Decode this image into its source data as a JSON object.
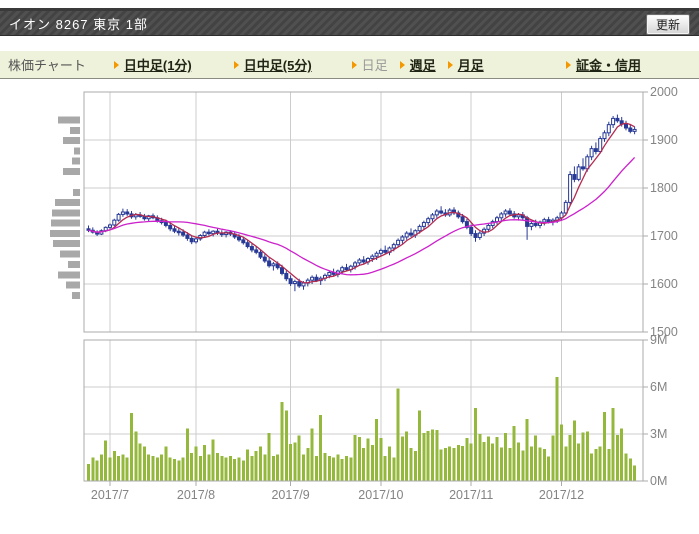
{
  "header": {
    "title": "イオン 8267 東京 1部",
    "refresh_button": "更新"
  },
  "tabbar": {
    "label": "株価チャート",
    "tabs": [
      {
        "id": "intraday-1min",
        "label": "日中足(1分)",
        "active": false
      },
      {
        "id": "intraday-5min",
        "label": "日中足(5分)",
        "active": false
      },
      {
        "id": "daily",
        "label": "日足",
        "active": true
      },
      {
        "id": "weekly",
        "label": "週足",
        "active": false
      },
      {
        "id": "monthly",
        "label": "月足",
        "active": false
      },
      {
        "id": "margin-credit",
        "label": "証金・信用",
        "active": false
      }
    ]
  },
  "colors": {
    "candle": "#283A96",
    "ma_short": "#B52B50",
    "ma_long": "#CC22CC",
    "volume_bar": "#93B83C",
    "profile_bar": "#A8A8A8",
    "grid": "#CCCCCC",
    "plot_border": "#ABABAB",
    "axis_text": "#848484",
    "tab_arrow": "#F39800",
    "tabbar_bg": "#EEF2DA"
  },
  "chart_data": [
    {
      "type": "candlestick",
      "ylim": [
        1500,
        2000
      ],
      "yticks": [
        2000,
        1900,
        1800,
        1700,
        1600,
        1500
      ],
      "grid": true,
      "legend": "none",
      "x_month_ticks": [
        {
          "day": 5,
          "label": "2017/7"
        },
        {
          "day": 25,
          "label": "2017/8"
        },
        {
          "day": 47,
          "label": "2017/9"
        },
        {
          "day": 68,
          "label": "2017/10"
        },
        {
          "day": 89,
          "label": "2017/11"
        },
        {
          "day": 110,
          "label": "2017/12"
        }
      ],
      "series": [
        {
          "name": "ohlc-candles",
          "type": "candle",
          "data": [
            [
              1715,
              1722,
              1708,
              1712
            ],
            [
              1712,
              1718,
              1705,
              1708
            ],
            [
              1708,
              1712,
              1700,
              1704
            ],
            [
              1704,
              1714,
              1702,
              1711
            ],
            [
              1711,
              1720,
              1708,
              1718
            ],
            [
              1718,
              1726,
              1714,
              1723
            ],
            [
              1723,
              1736,
              1720,
              1733
            ],
            [
              1733,
              1748,
              1730,
              1745
            ],
            [
              1745,
              1757,
              1740,
              1750
            ],
            [
              1750,
              1756,
              1742,
              1746
            ],
            [
              1746,
              1752,
              1736,
              1740
            ],
            [
              1740,
              1748,
              1734,
              1744
            ],
            [
              1744,
              1750,
              1738,
              1741
            ],
            [
              1741,
              1746,
              1732,
              1736
            ],
            [
              1736,
              1744,
              1730,
              1742
            ],
            [
              1742,
              1747,
              1735,
              1738
            ],
            [
              1738,
              1743,
              1728,
              1732
            ],
            [
              1732,
              1738,
              1724,
              1728
            ],
            [
              1728,
              1734,
              1718,
              1722
            ],
            [
              1722,
              1727,
              1710,
              1715
            ],
            [
              1715,
              1721,
              1706,
              1710
            ],
            [
              1710,
              1716,
              1701,
              1708
            ],
            [
              1708,
              1714,
              1698,
              1702
            ],
            [
              1702,
              1708,
              1690,
              1695
            ],
            [
              1695,
              1701,
              1683,
              1688
            ],
            [
              1688,
              1697,
              1684,
              1694
            ],
            [
              1694,
              1704,
              1690,
              1701
            ],
            [
              1701,
              1711,
              1697,
              1708
            ],
            [
              1708,
              1714,
              1701,
              1705
            ],
            [
              1705,
              1712,
              1699,
              1710
            ],
            [
              1710,
              1715,
              1702,
              1706
            ],
            [
              1706,
              1712,
              1698,
              1703
            ],
            [
              1703,
              1710,
              1697,
              1708
            ],
            [
              1708,
              1712,
              1700,
              1704
            ],
            [
              1704,
              1709,
              1694,
              1698
            ],
            [
              1698,
              1704,
              1688,
              1692
            ],
            [
              1692,
              1698,
              1682,
              1686
            ],
            [
              1686,
              1692,
              1674,
              1678
            ],
            [
              1678,
              1684,
              1666,
              1671
            ],
            [
              1671,
              1679,
              1662,
              1666
            ],
            [
              1666,
              1672,
              1652,
              1656
            ],
            [
              1656,
              1662,
              1644,
              1648
            ],
            [
              1648,
              1654,
              1634,
              1638
            ],
            [
              1638,
              1646,
              1628,
              1642
            ],
            [
              1642,
              1647,
              1630,
              1634
            ],
            [
              1634,
              1640,
              1618,
              1622
            ],
            [
              1622,
              1628,
              1606,
              1611
            ],
            [
              1611,
              1618,
              1596,
              1601
            ],
            [
              1601,
              1609,
              1585,
              1605
            ],
            [
              1605,
              1611,
              1592,
              1596
            ],
            [
              1596,
              1606,
              1588,
              1602
            ],
            [
              1602,
              1612,
              1595,
              1608
            ],
            [
              1608,
              1618,
              1600,
              1614
            ],
            [
              1614,
              1620,
              1604,
              1607
            ],
            [
              1607,
              1616,
              1598,
              1612
            ],
            [
              1612,
              1622,
              1606,
              1618
            ],
            [
              1618,
              1628,
              1612,
              1624
            ],
            [
              1624,
              1632,
              1616,
              1620
            ],
            [
              1620,
              1630,
              1614,
              1627
            ],
            [
              1627,
              1638,
              1621,
              1634
            ],
            [
              1634,
              1642,
              1626,
              1630
            ],
            [
              1630,
              1640,
              1624,
              1637
            ],
            [
              1637,
              1648,
              1630,
              1644
            ],
            [
              1644,
              1654,
              1638,
              1650
            ],
            [
              1650,
              1658,
              1642,
              1646
            ],
            [
              1646,
              1656,
              1640,
              1653
            ],
            [
              1653,
              1662,
              1646,
              1658
            ],
            [
              1658,
              1668,
              1650,
              1664
            ],
            [
              1664,
              1674,
              1658,
              1670
            ],
            [
              1670,
              1680,
              1662,
              1666
            ],
            [
              1666,
              1678,
              1660,
              1675
            ],
            [
              1675,
              1686,
              1668,
              1682
            ],
            [
              1682,
              1695,
              1676,
              1691
            ],
            [
              1691,
              1702,
              1684,
              1698
            ],
            [
              1698,
              1710,
              1692,
              1706
            ],
            [
              1706,
              1716,
              1698,
              1702
            ],
            [
              1702,
              1714,
              1696,
              1711
            ],
            [
              1711,
              1724,
              1705,
              1720
            ],
            [
              1720,
              1732,
              1714,
              1728
            ],
            [
              1728,
              1740,
              1722,
              1736
            ],
            [
              1736,
              1748,
              1730,
              1744
            ],
            [
              1744,
              1756,
              1738,
              1752
            ],
            [
              1752,
              1762,
              1745,
              1748
            ],
            [
              1748,
              1756,
              1740,
              1744
            ],
            [
              1744,
              1758,
              1740,
              1754
            ],
            [
              1754,
              1760,
              1744,
              1748
            ],
            [
              1748,
              1753,
              1736,
              1740
            ],
            [
              1740,
              1746,
              1726,
              1730
            ],
            [
              1730,
              1736,
              1714,
              1718
            ],
            [
              1718,
              1724,
              1700,
              1705
            ],
            [
              1705,
              1712,
              1688,
              1697
            ],
            [
              1697,
              1710,
              1692,
              1706
            ],
            [
              1706,
              1718,
              1700,
              1714
            ],
            [
              1714,
              1726,
              1708,
              1722
            ],
            [
              1722,
              1734,
              1716,
              1730
            ],
            [
              1730,
              1742,
              1724,
              1738
            ],
            [
              1738,
              1750,
              1732,
              1746
            ],
            [
              1746,
              1756,
              1740,
              1752
            ],
            [
              1752,
              1758,
              1742,
              1746
            ],
            [
              1746,
              1752,
              1736,
              1740
            ],
            [
              1740,
              1748,
              1732,
              1744
            ],
            [
              1744,
              1750,
              1734,
              1738
            ],
            [
              1738,
              1742,
              1692,
              1720
            ],
            [
              1720,
              1730,
              1712,
              1726
            ],
            [
              1726,
              1734,
              1718,
              1722
            ],
            [
              1722,
              1732,
              1716,
              1729
            ],
            [
              1729,
              1738,
              1722,
              1734
            ],
            [
              1734,
              1740,
              1726,
              1730
            ],
            [
              1730,
              1737,
              1722,
              1733
            ],
            [
              1733,
              1742,
              1727,
              1738
            ],
            [
              1738,
              1752,
              1732,
              1748
            ],
            [
              1748,
              1775,
              1744,
              1770
            ],
            [
              1770,
              1835,
              1765,
              1828
            ],
            [
              1828,
              1845,
              1812,
              1818
            ],
            [
              1818,
              1850,
              1814,
              1844
            ],
            [
              1844,
              1862,
              1836,
              1840
            ],
            [
              1840,
              1870,
              1834,
              1865
            ],
            [
              1865,
              1888,
              1858,
              1882
            ],
            [
              1882,
              1895,
              1870,
              1876
            ],
            [
              1876,
              1908,
              1872,
              1903
            ],
            [
              1903,
              1920,
              1896,
              1915
            ],
            [
              1915,
              1938,
              1908,
              1932
            ],
            [
              1932,
              1950,
              1925,
              1945
            ],
            [
              1945,
              1953,
              1936,
              1940
            ],
            [
              1940,
              1948,
              1928,
              1933
            ],
            [
              1933,
              1940,
              1920,
              1925
            ],
            [
              1925,
              1932,
              1914,
              1918
            ],
            [
              1918,
              1928,
              1912,
              1922
            ]
          ]
        },
        {
          "name": "ma-short",
          "type": "line",
          "derived": "sma",
          "period": 5,
          "color_key": "ma_short"
        },
        {
          "name": "ma-long",
          "type": "line",
          "derived": "sma",
          "period": 20,
          "color_key": "ma_long"
        }
      ],
      "volume_by_price": {
        "price_levels": [
          1942,
          1920,
          1899,
          1877,
          1856,
          1834,
          1813,
          1791,
          1770,
          1748,
          1727,
          1705,
          1684,
          1662,
          1641,
          1619,
          1598,
          1576
        ],
        "relative_widths": [
          22,
          10,
          17,
          6,
          8,
          17,
          0,
          7,
          25,
          28,
          29,
          30,
          27,
          20,
          12,
          22,
          14,
          8
        ]
      }
    },
    {
      "type": "bar",
      "name": "volume",
      "ylim_millions": [
        0,
        9
      ],
      "yticks": [
        {
          "v": 9,
          "label": "9M"
        },
        {
          "v": 6,
          "label": "6M"
        },
        {
          "v": 3,
          "label": "3M"
        },
        {
          "v": 0,
          "label": "0M"
        }
      ],
      "values_millions": [
        1.1,
        1.5,
        1.3,
        1.7,
        2.6,
        1.5,
        1.9,
        1.6,
        1.7,
        1.5,
        4.35,
        3.15,
        2.4,
        2.2,
        1.7,
        1.6,
        1.5,
        1.7,
        2.2,
        1.5,
        1.4,
        1.3,
        1.5,
        3.35,
        1.8,
        2.2,
        1.6,
        2.3,
        1.7,
        2.65,
        1.8,
        1.6,
        1.5,
        1.6,
        1.4,
        1.5,
        1.3,
        2.0,
        1.6,
        1.9,
        2.2,
        1.7,
        3.05,
        1.6,
        1.7,
        5.05,
        4.5,
        2.35,
        2.45,
        2.9,
        1.7,
        2.1,
        3.35,
        1.6,
        4.2,
        1.8,
        1.6,
        1.5,
        1.7,
        1.4,
        1.6,
        1.5,
        2.95,
        2.8,
        2.1,
        2.7,
        2.3,
        3.95,
        2.75,
        1.6,
        2.2,
        1.5,
        5.9,
        2.85,
        3.15,
        2.1,
        1.9,
        4.5,
        3.05,
        3.2,
        3.3,
        3.25,
        2.0,
        2.1,
        2.2,
        2.1,
        2.3,
        2.25,
        2.75,
        2.4,
        4.65,
        3.0,
        2.5,
        2.85,
        2.4,
        2.8,
        2.15,
        3.05,
        2.1,
        3.5,
        2.45,
        1.95,
        3.95,
        2.2,
        2.9,
        2.15,
        2.05,
        1.55,
        2.9,
        6.65,
        3.6,
        2.2,
        2.95,
        3.85,
        2.4,
        3.1,
        3.15,
        1.75,
        2.05,
        2.2,
        4.4,
        2.05,
        4.65,
        2.95,
        3.35,
        1.75,
        1.45,
        1.0
      ],
      "x_labels": [
        "2017/7",
        "2017/8",
        "2017/9",
        "2017/10",
        "2017/11",
        "2017/12"
      ]
    }
  ]
}
